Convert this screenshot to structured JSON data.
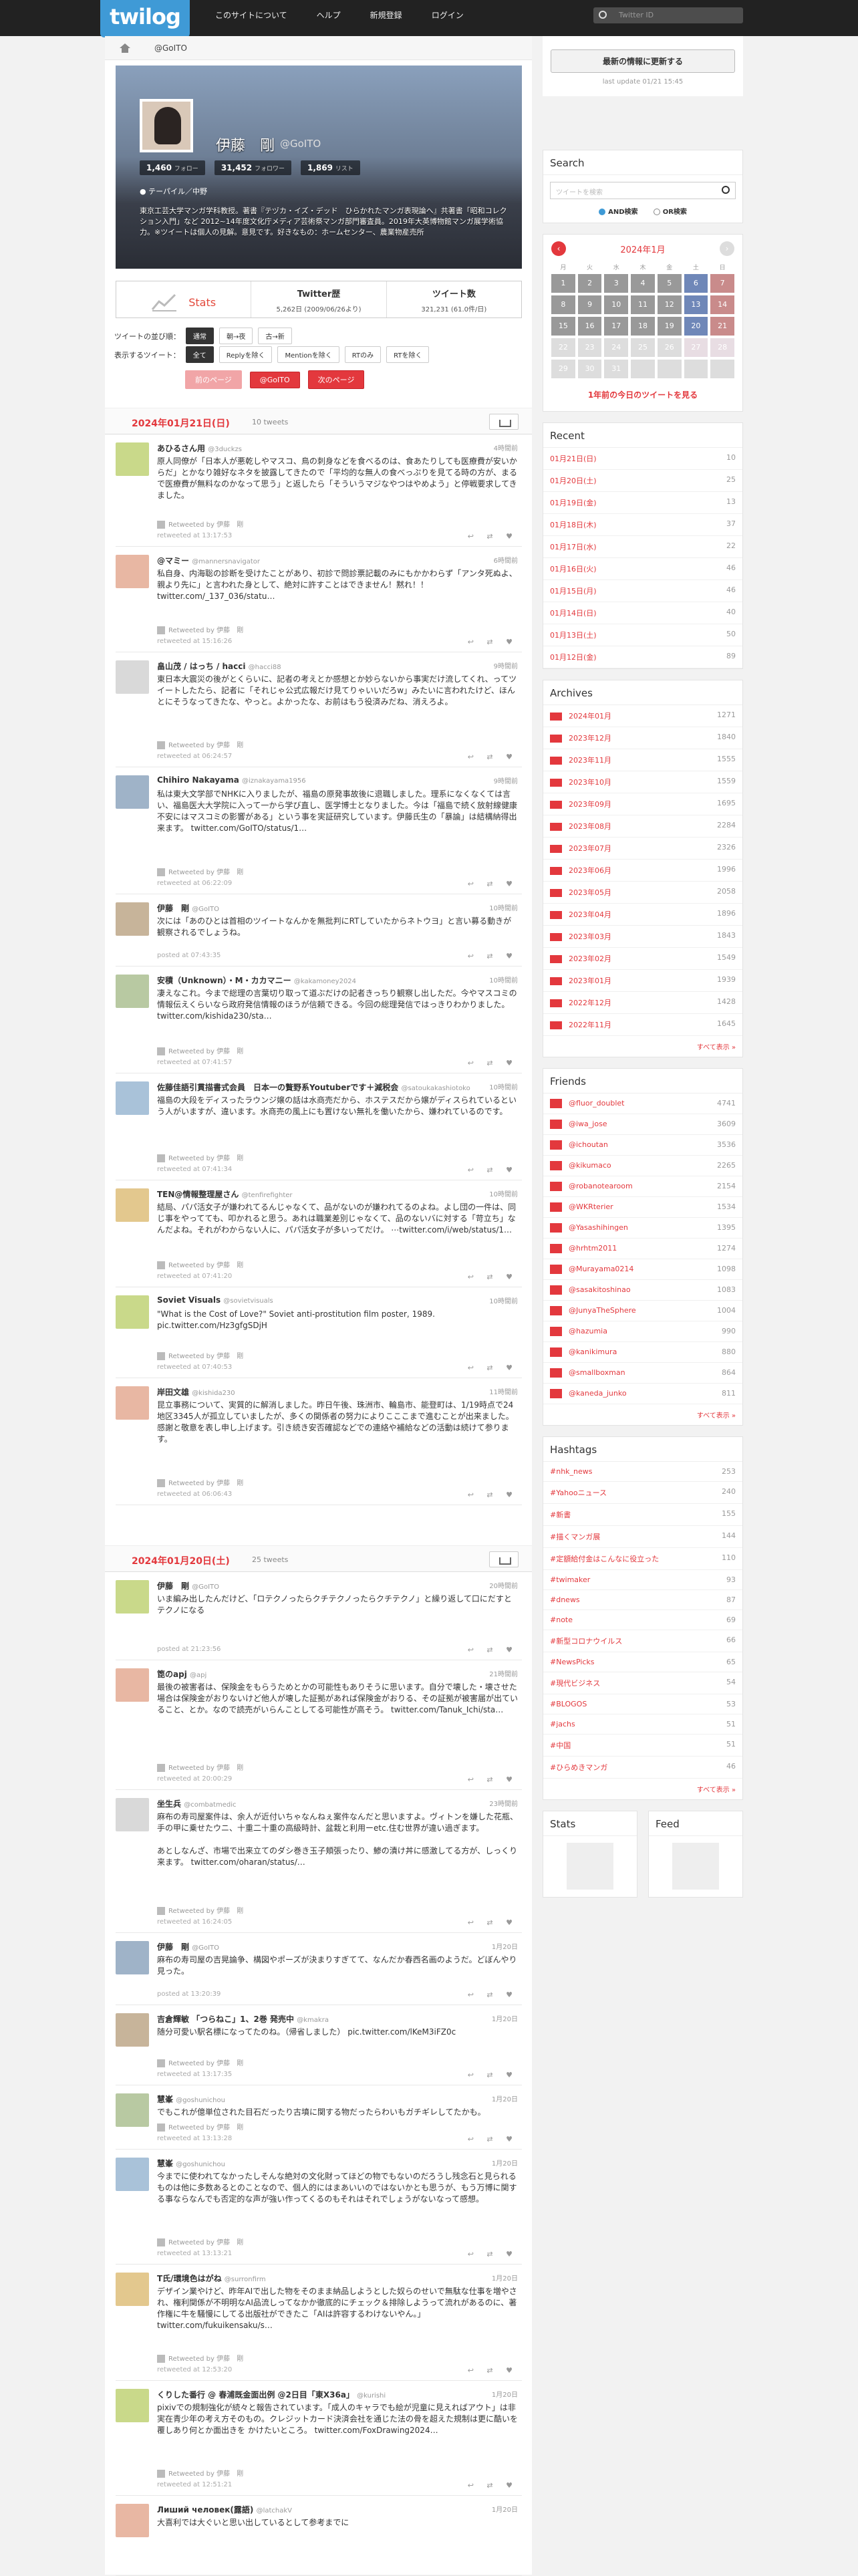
{
  "header": {
    "logo": "twilog",
    "nav": [
      "このサイトについて",
      "ヘルプ",
      "新規登録",
      "ログイン"
    ],
    "search_placeholder": "Twitter ID"
  },
  "breadcrumb": "@GoITO",
  "profile": {
    "name": "伊藤　剛",
    "screen": "@GoITO",
    "counts": [
      {
        "n": "1,460",
        "l": "フォロー"
      },
      {
        "n": "31,452",
        "l": "フォロワー"
      },
      {
        "n": "1,869",
        "l": "リスト"
      }
    ],
    "location": "テーパイル／中野",
    "bio": "東京工芸大学マンガ学科教授。著書『テヅカ・イズ・デッド　ひらかれたマンガ表現論へ』共著書「昭和コレクション入門」など 2012~14年度文化庁メディア芸術祭マンガ部門審査員。2019年大英博物館マンガ展学術協力。※ツイートは個人の見解。意見です。好きなもの：ホームセンター、農業物産売所"
  },
  "stats": {
    "label": "Stats",
    "twitter_label": "Twitter歴",
    "twitter_value": "5,262日 (2009/06/26より)",
    "tweets_label": "ツイート数",
    "tweets_value": "321,231 (61.0件/日)"
  },
  "controls": {
    "sort_label": "ツイートの並び順：",
    "sort": [
      "通常",
      "朝→夜",
      "古→新"
    ],
    "show_label": "表示するツイート：",
    "show": [
      "全て",
      "Replyを除く",
      "Mentionを除く",
      "RTのみ",
      "RTを除く"
    ],
    "prev": "前のページ",
    "user": "@GoITO",
    "next": "次のページ"
  },
  "day1": {
    "date": "2024年01月21日(日)",
    "count": "10 tweets"
  },
  "day2": {
    "date": "2024年01月20日(土)",
    "count": "25 tweets"
  },
  "tweets1": [
    {
      "name": "あひるさん用",
      "sn": "@3duckzs",
      "time": "4時間前",
      "body": "原人同僚が「日本人が悪乾しやマスコ、鳥の刺身などを食べるのは、食あたりしても医療費が安いからだ」とかなり雑好なネタを披露してきたので「平均的な無人の食べっぷりを見てる時の方が、まるで医療費が無料なのかなって思う」と返したら「そういうマジなやつはやめよう」と停戦要求してきました。",
      "rt": "Retweeted by 伊藤　剛",
      "meta": "retweeted at 13:17:53"
    },
    {
      "name": "@マミー",
      "sn": "@mannersnavigator",
      "time": "6時間前",
      "body": "私自身、内海聡の診断を受けたことがあり、初診で問診票記載のみにもかかわらず「アンタ死ぬよ、親より先に」と言われた身として、絶対に許すことはできません！黙れ！！ twitter.com/_137_036/statu…",
      "rt": "Retweeted by 伊藤　剛",
      "meta": "retweeted at 15:16:26"
    },
    {
      "name": "畠山茂 / はっち / hacci",
      "sn": "@hacci88",
      "time": "9時間前",
      "body": "東日本大震災の後がとくらいに、記者の考えとか感想とか妙らないから事実だけ流してくれ、ってツイートしたたら、記者に「それじゃ公式広報だけ見てりゃいいだろw」みたいに言われたけど、ほんとにそうなってきたな、やっと。よかったな、お前はもう役済みだね、消えろよ。",
      "rt": "Retweeted by 伊藤　剛",
      "meta": "retweeted at 06:24:57"
    },
    {
      "name": "Chihiro Nakayama",
      "sn": "@iznakayama1956",
      "time": "9時間前",
      "body": "私は東大文学部でNHKに入りましたが、福島の原発事故後に退職しました。理系になくなくては言い、福島医大大学院に入って一から学び直し、医学博士となりました。今は「福島で続く放射線健康不安にはマスコミの影響がある」という事を実証研究しています。伊藤氏生の「暴論」は結構納得出来ます。 twitter.com/GoITO/status/1…",
      "rt": "Retweeted by 伊藤　剛",
      "meta": "retweeted at 06:22:09"
    },
    {
      "name": "伊藤　剛",
      "sn": "@GoITO",
      "time": "10時間前",
      "body": "次には「あのひとは首相のツイートなんかを無批判にRTしていたからネトウヨ」と言い募る動きが観察されるでしょうね。",
      "rt": "",
      "meta": "posted at 07:43:35"
    },
    {
      "name": "安積（Unknown）・M・カカマニー",
      "sn": "@kakamoney2024",
      "time": "10時間前",
      "body": "凄えなこれ。今まで総理の言葉切り取って道ぶだけの記者きっちり観察し出しただ。今やマスコミの情報伝えくらいなら政府発信情報のほうが信頼できる。今回の総理発信ではっきりわかりました。 twitter.com/kishida230/sta…",
      "rt": "Retweeted by 伊藤　剛",
      "meta": "retweeted at 07:41:57"
    },
    {
      "name": "佐藤佳語引貫描書式会員　日本一の贅野系Youtuberです＋減税会",
      "sn": "@satoukakashiotoko",
      "time": "10時間前",
      "body": "福島の大段をディスったラウンジ嬢の話は水商売だから、ホステスだから嬢がディスられているという人がいますが、違います。水商売の風上にも置けない無礼を働いたから、嫌われているのです。",
      "rt": "Retweeted by 伊藤　剛",
      "meta": "retweeted at 07:41:34"
    },
    {
      "name": "TEN@情報整理屋さん",
      "sn": "@tenfirefighter",
      "time": "10時間前",
      "body": "結局、パパ活女子が嫌われてるんじゃなくて、品がないのが嫌われてるのよね。よし団の一件は、同じ事をやってても、叩かれると思う。あれは職業差別じゃなくて、品のないバに対する「苛立ち」なんだよね。それがわからない人に、パパ活女子が多いってだけ。 ⋯twitter.com/i/web/status/1…",
      "rt": "Retweeted by 伊藤　剛",
      "meta": "retweeted at 07:41:20"
    },
    {
      "name": "Soviet Visuals",
      "sn": "@sovietvisuals",
      "time": "10時間前",
      "body": "\"What is the Cost of Love?\" Soviet anti-prostitution film poster, 1989. pic.twitter.com/Hz3gfgSDjH",
      "rt": "Retweeted by 伊藤　剛",
      "meta": "retweeted at 07:40:53"
    },
    {
      "name": "岸田文雄",
      "sn": "@kishida230",
      "time": "11時間前",
      "body": "昆立事務について、実質的に解消しました。昨日午後、珠洲市、輪島市、能登町は、1/19時点で24地区3345人が孤立していましたが、多くの関係者の努力によりこここまで進むことが出来ました。感謝と敬意を表し申し上げます。引き続き安否確認などでの連絡や補給などの活動は続けて参ります。",
      "rt": "Retweeted by 伊藤　剛",
      "meta": "retweeted at 06:06:43"
    }
  ],
  "tweets2": [
    {
      "name": "伊藤　剛",
      "sn": "@GoITO",
      "time": "20時間前",
      "body": "いま編み出したんだけど、「ロテクノったらクチテクノったらクチテクノ」と繰り返して口にだすとテクノになる",
      "rt": "",
      "meta": "posted at 21:23:56"
    },
    {
      "name": "箆のapj",
      "sn": "@apj",
      "time": "21時間前",
      "body": "最後の被害者は、保険金をもらうためとかの可能性もありそうに思います。自分で壊した・壊させた場合は保険金がおりないけど他人が壊した証拠があれば保険金がおりる、その証拠が被害届が出ていること、とか。なので読売がいらんことしてる可能性が高そう。 twitter.com/Tanuk_Ichi/sta…",
      "rt": "Retweeted by 伊藤　剛",
      "meta": "retweeted at 20:00:29"
    },
    {
      "name": "坐生兵",
      "sn": "@combatmedic",
      "time": "23時間前",
      "body": "麻布の寿司屋案件は、余人が近付いちゃなんねぇ案件なんだと思いますよ。ヴィトンを嫌した花瓶、手の甲に乗せたウニ、十重二十重の高級時計、盆栽と利用ーetc.住む世界が違い過ぎます。\n\nあとしなんざ、市場で出来立てのダシ巻き玉子頬張ったり、鯵の漬け丼に感激してる方が、しっくり来ます。 twitter.com/oharan/status/…",
      "rt": "Retweeted by 伊藤　剛",
      "meta": "retweeted at 16:24:05"
    },
    {
      "name": "伊藤　剛",
      "sn": "@GoITO",
      "time": "1月20日",
      "body": "麻布の寿司屋の吉晃論争、構図やポーズが決まりすぎてて、なんだか春西名画のようだ。どぼんやり見った。",
      "rt": "",
      "meta": "posted at 13:20:39"
    },
    {
      "name": "吉倉輝敏 「つらねこ」1、2巻 発売中",
      "sn": "@kmakra",
      "time": "1月20日",
      "body": "随分可愛い駅名標になってたのね。（帰省しました） pic.twitter.com/lKeM3iFZ0c",
      "rt": "Retweeted by 伊藤　剛",
      "meta": "retweeted at 13:17:35"
    },
    {
      "name": "慧峯",
      "sn": "@goshunichou",
      "time": "1月20日",
      "body": "でもこれが億単位された目石だったり古墳に関する物だったらわいもガチギレしてたかも。",
      "rt": "Retweeted by 伊藤　剛",
      "meta": "retweeted at 13:13:28"
    },
    {
      "name": "慧峯",
      "sn": "@goshunichou",
      "time": "1月20日",
      "body": "今までに使われてなかったしそんな絶対の文化財ってほどの物でもないのだろうし残念石と見られるものは他に多数あるとのことなので、個人的にはまあいいのではないかとも思うが、もう万博に関する事ならなんでも否定的な声が強い作ってくるのもそれはそれでしょうがないなって感想。",
      "rt": "Retweeted by 伊藤　剛",
      "meta": "retweeted at 13:13:21"
    },
    {
      "name": "T氏/環境色はがね",
      "sn": "@surronfirm",
      "time": "1月20日",
      "body": "デザイン業やけど、昨年AIで出した物をそのまま納品しようとした奴らのせいで無駄な仕事を増やされ、権利関係が不明明なAI品流しってなかか徹底的にチェック＆排除しようって流れがあるのに、著作権に牛を騒慢にしてる出版社ができたこ「AIは許容するわけないやん。」 twitter.com/fukuikensaku/s…",
      "rt": "Retweeted by 伊藤　剛",
      "meta": "retweeted at 12:53:20"
    },
    {
      "name": "くりした番行 @ 春浦既金面出例 @2日目「東X36a」",
      "sn": "@kurishi",
      "time": "1月20日",
      "body": "pixivでの規制強化が続々と報告されています。「成人のキャラでも絵が児童に見えればアウト」は非実在青少年の考え方そのもの。クレジットカード決済会社を通じた法の骨を超えた規制は更に酷いを覆しあり何とか面出きを かけたいところ。 twitter.com/FoxDrawing2024…",
      "rt": "Retweeted by 伊藤　剛",
      "meta": "retweeted at 12:51:21"
    },
    {
      "name": "Лиший человек(露語)",
      "sn": "@latchakV",
      "time": "1月20日",
      "body": "大喜利では大ぐいと思い出しているとして参考までに",
      "rt": "",
      "meta": ""
    }
  ],
  "side": {
    "update_button": "最新の情報に更新する",
    "last_update": "last update 01/21 15:45",
    "search_title": "Search",
    "search_placeholder": "ツイートを検索",
    "and": "AND検索",
    "or": "OR検索",
    "cal_month": "2024年1月",
    "weekdays": [
      "月",
      "火",
      "水",
      "木",
      "金",
      "土",
      "日"
    ],
    "cal_days": [
      "1",
      "2",
      "3",
      "4",
      "5",
      "6",
      "7",
      "8",
      "9",
      "10",
      "11",
      "12",
      "13",
      "14",
      "15",
      "16",
      "17",
      "18",
      "19",
      "20",
      "21",
      "22",
      "23",
      "24",
      "25",
      "26",
      "27",
      "28",
      "29",
      "30",
      "31"
    ],
    "cal_today": "1年前の今日のツイートを見る",
    "recent_title": "Recent",
    "recent": [
      {
        "n": "01月21日(日)",
        "c": "10"
      },
      {
        "n": "01月20日(土)",
        "c": "25"
      },
      {
        "n": "01月19日(金)",
        "c": "13"
      },
      {
        "n": "01月18日(木)",
        "c": "37"
      },
      {
        "n": "01月17日(水)",
        "c": "22"
      },
      {
        "n": "01月16日(火)",
        "c": "46"
      },
      {
        "n": "01月15日(月)",
        "c": "46"
      },
      {
        "n": "01月14日(日)",
        "c": "40"
      },
      {
        "n": "01月13日(土)",
        "c": "50"
      },
      {
        "n": "01月12日(金)",
        "c": "89"
      }
    ],
    "archives_title": "Archives",
    "archives": [
      {
        "n": "2024年01月",
        "c": "1271"
      },
      {
        "n": "2023年12月",
        "c": "1840"
      },
      {
        "n": "2023年11月",
        "c": "1555"
      },
      {
        "n": "2023年10月",
        "c": "1559"
      },
      {
        "n": "2023年09月",
        "c": "1695"
      },
      {
        "n": "2023年08月",
        "c": "2284"
      },
      {
        "n": "2023年07月",
        "c": "2326"
      },
      {
        "n": "2023年06月",
        "c": "1996"
      },
      {
        "n": "2023年05月",
        "c": "2058"
      },
      {
        "n": "2023年04月",
        "c": "1896"
      },
      {
        "n": "2023年03月",
        "c": "1843"
      },
      {
        "n": "2023年02月",
        "c": "1549"
      },
      {
        "n": "2023年01月",
        "c": "1939"
      },
      {
        "n": "2022年12月",
        "c": "1428"
      },
      {
        "n": "2022年11月",
        "c": "1645"
      }
    ],
    "archives_more": "すべて表示 »",
    "friends_title": "Friends",
    "friends": [
      {
        "n": "@fluor_doublet",
        "c": "4741"
      },
      {
        "n": "@iwa_jose",
        "c": "3609"
      },
      {
        "n": "@ichoutan",
        "c": "3536"
      },
      {
        "n": "@kikumaco",
        "c": "2265"
      },
      {
        "n": "@robanotearoom",
        "c": "2154"
      },
      {
        "n": "@WKRterier",
        "c": "1534"
      },
      {
        "n": "@Yasashihingen",
        "c": "1395"
      },
      {
        "n": "@hrhtm2011",
        "c": "1274"
      },
      {
        "n": "@Murayama0214",
        "c": "1098"
      },
      {
        "n": "@sasakitoshinao",
        "c": "1083"
      },
      {
        "n": "@JunyaTheSphere",
        "c": "1004"
      },
      {
        "n": "@hazumia",
        "c": "990"
      },
      {
        "n": "@kanikimura",
        "c": "880"
      },
      {
        "n": "@smallboxman",
        "c": "864"
      },
      {
        "n": "@kaneda_junko",
        "c": "811"
      }
    ],
    "friends_more": "すべて表示 »",
    "hashtags_title": "Hashtags",
    "hashtags": [
      {
        "n": "#nhk_news",
        "c": "253"
      },
      {
        "n": "#Yahooニュース",
        "c": "240"
      },
      {
        "n": "#新書",
        "c": "155"
      },
      {
        "n": "#描くマンガ展",
        "c": "144"
      },
      {
        "n": "#定額給付金はこんなに役立った",
        "c": "110"
      },
      {
        "n": "#twimaker",
        "c": "93"
      },
      {
        "n": "#dnews",
        "c": "87"
      },
      {
        "n": "#note",
        "c": "69"
      },
      {
        "n": "#新型コロナウイルス",
        "c": "66"
      },
      {
        "n": "#NewsPicks",
        "c": "65"
      },
      {
        "n": "#現代ビジネス",
        "c": "54"
      },
      {
        "n": "#BLOGOS",
        "c": "53"
      },
      {
        "n": "#jachs",
        "c": "51"
      },
      {
        "n": "#中国",
        "c": "51"
      },
      {
        "n": "#ひらめきマンガ",
        "c": "46"
      }
    ],
    "hashtags_more": "すべて表示 »",
    "stats_title": "Stats",
    "feed_title": "Feed"
  },
  "colors": {
    "accent": "#e3383d",
    "logo": "#3f9ad6"
  }
}
